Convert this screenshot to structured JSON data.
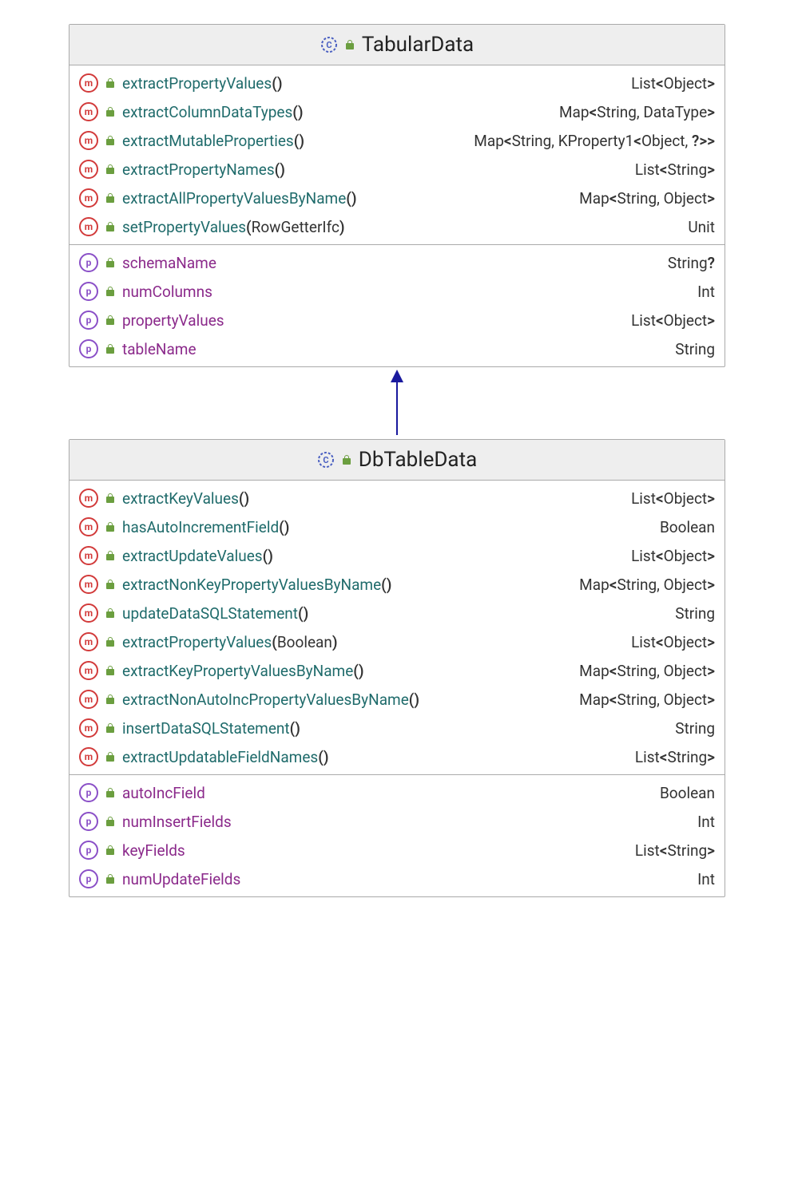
{
  "parent": {
    "name": "TabularData",
    "methods": [
      {
        "name": "extractPropertyValues",
        "params": "",
        "ret": "List<Object>"
      },
      {
        "name": "extractColumnDataTypes",
        "params": "",
        "ret": "Map<String, DataType>"
      },
      {
        "name": "extractMutableProperties",
        "params": "",
        "ret": "Map<String, KProperty1<Object, ?>>"
      },
      {
        "name": "extractPropertyNames",
        "params": "",
        "ret": "List<String>"
      },
      {
        "name": "extractAllPropertyValuesByName",
        "params": "",
        "ret": "Map<String, Object>"
      },
      {
        "name": "setPropertyValues",
        "params": "RowGetterIfc",
        "ret": "Unit"
      }
    ],
    "properties": [
      {
        "name": "schemaName",
        "ret": "String?"
      },
      {
        "name": "numColumns",
        "ret": "Int"
      },
      {
        "name": "propertyValues",
        "ret": "List<Object>"
      },
      {
        "name": "tableName",
        "ret": "String"
      }
    ]
  },
  "child": {
    "name": "DbTableData",
    "methods": [
      {
        "name": "extractKeyValues",
        "params": "",
        "ret": "List<Object>"
      },
      {
        "name": "hasAutoIncrementField",
        "params": "",
        "ret": "Boolean"
      },
      {
        "name": "extractUpdateValues",
        "params": "",
        "ret": "List<Object>"
      },
      {
        "name": "extractNonKeyPropertyValuesByName",
        "params": "",
        "ret": "Map<String, Object>"
      },
      {
        "name": "updateDataSQLStatement",
        "params": "",
        "ret": "String"
      },
      {
        "name": "extractPropertyValues",
        "params": "Boolean",
        "ret": "List<Object>"
      },
      {
        "name": "extractKeyPropertyValuesByName",
        "params": "",
        "ret": "Map<String, Object>"
      },
      {
        "name": "extractNonAutoIncPropertyValuesByName",
        "params": "",
        "ret": "Map<String, Object>"
      },
      {
        "name": "insertDataSQLStatement",
        "params": "",
        "ret": "String"
      },
      {
        "name": "extractUpdatableFieldNames",
        "params": "",
        "ret": "List<String>"
      }
    ],
    "properties": [
      {
        "name": "autoIncField",
        "ret": "Boolean"
      },
      {
        "name": "numInsertFields",
        "ret": "Int"
      },
      {
        "name": "keyFields",
        "ret": "List<String>"
      },
      {
        "name": "numUpdateFields",
        "ret": "Int"
      }
    ]
  }
}
